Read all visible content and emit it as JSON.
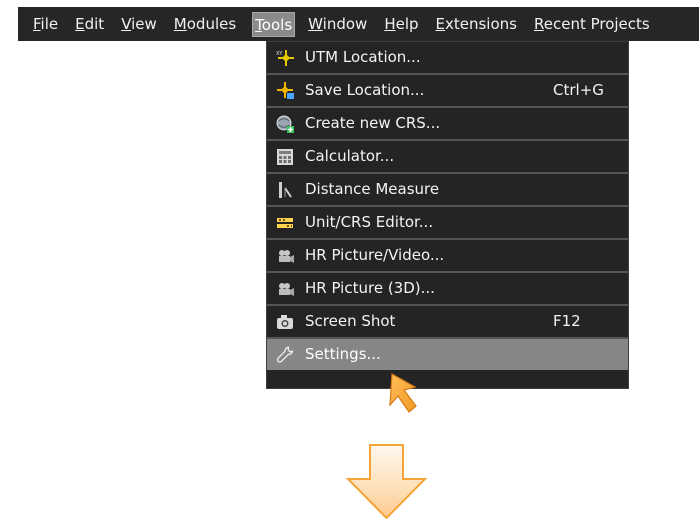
{
  "menubar": {
    "items": [
      {
        "label": "File"
      },
      {
        "label": "Edit"
      },
      {
        "label": "View"
      },
      {
        "label": "Modules"
      },
      {
        "label": "Tools"
      },
      {
        "label": "Window"
      },
      {
        "label": "Help"
      },
      {
        "label": "Extensions"
      },
      {
        "label": "Recent Projects"
      }
    ],
    "active_item": "Tools"
  },
  "tools_menu": {
    "items": [
      {
        "label": "UTM Location...",
        "icon": "utm-location-icon"
      },
      {
        "label": "Save Location...",
        "shortcut": "Ctrl+G",
        "icon": "save-location-icon"
      },
      {
        "label": "Create new CRS...",
        "icon": "create-crs-icon"
      },
      {
        "label": "Calculator...",
        "icon": "calculator-icon"
      },
      {
        "label": "Distance Measure",
        "icon": "distance-measure-icon"
      },
      {
        "label": "Unit/CRS Editor...",
        "icon": "unit-crs-editor-icon"
      },
      {
        "label": "HR Picture/Video...",
        "icon": "camera-video-icon"
      },
      {
        "label": "HR Picture (3D)...",
        "icon": "camera-3d-icon"
      },
      {
        "label": "Screen Shot",
        "shortcut": "F12",
        "icon": "camera-icon"
      },
      {
        "label": "Settings...",
        "icon": "wrench-icon",
        "highlighted": true
      }
    ]
  },
  "icons": {
    "pointer_arrow": "orange-pointer-arrow-icon",
    "down_arrow": "orange-down-arrow-icon"
  },
  "colors": {
    "menubar_bg": "#262626",
    "menu_bg": "#242424",
    "menu_highlight": "#868686",
    "arrow_orange": "#f4a335",
    "arrow_light_orange": "#fde0b8"
  }
}
